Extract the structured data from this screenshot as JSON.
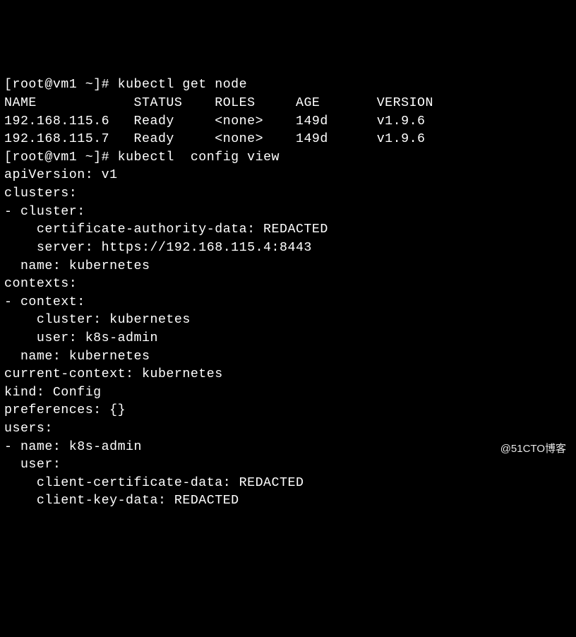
{
  "prompt1": {
    "prefix": "[root@vm1 ~]# ",
    "command": "kubectl get node"
  },
  "table": {
    "headers": [
      "NAME",
      "STATUS",
      "ROLES",
      "AGE",
      "VERSION"
    ],
    "rows": [
      {
        "name": "192.168.115.6",
        "status": "Ready",
        "roles": "<none>",
        "age": "149d",
        "version": "v1.9.6"
      },
      {
        "name": "192.168.115.7",
        "status": "Ready",
        "roles": "<none>",
        "age": "149d",
        "version": "v1.9.6"
      }
    ]
  },
  "prompt2": {
    "prefix": "[root@vm1 ~]# ",
    "command": "kubectl  config view"
  },
  "config": {
    "l1": "apiVersion: v1",
    "l2": "clusters:",
    "l3": "- cluster:",
    "l4": "    certificate-authority-data: REDACTED",
    "l5": "    server: https://192.168.115.4:8443",
    "l6": "  name: kubernetes",
    "l7": "contexts:",
    "l8": "- context:",
    "l9": "    cluster: kubernetes",
    "l10": "    user: k8s-admin",
    "l11": "  name: kubernetes",
    "l12": "current-context: kubernetes",
    "l13": "kind: Config",
    "l14": "preferences: {}",
    "l15": "users:",
    "l16": "- name: k8s-admin",
    "l17": "  user:",
    "l18": "    client-certificate-data: REDACTED",
    "l19": "    client-key-data: REDACTED"
  },
  "watermark": "@51CTO博客"
}
